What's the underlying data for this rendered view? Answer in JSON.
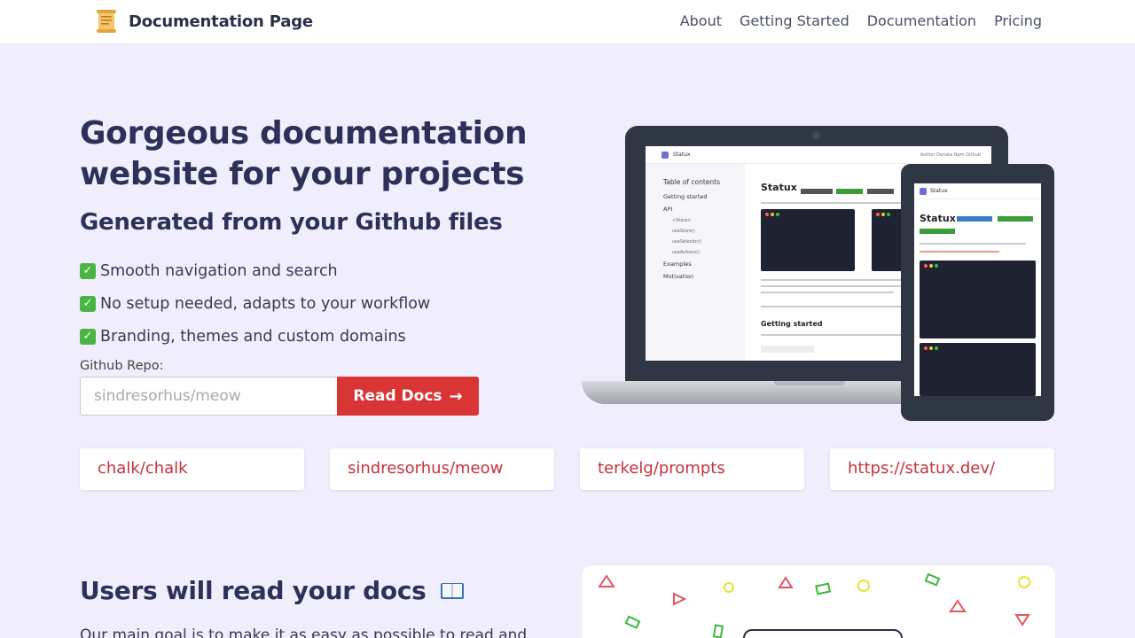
{
  "nav": {
    "brand": "Documentation Page",
    "links": [
      "About",
      "Getting Started",
      "Documentation",
      "Pricing"
    ]
  },
  "hero": {
    "title": "Gorgeous documentation website for your projects",
    "subtitle": "Generated from your Github files",
    "features": [
      "Smooth navigation and search",
      "No setup needed, adapts to your workflow",
      "Branding, themes and custom domains"
    ],
    "repo_label": "Github Repo:",
    "repo_placeholder": "sindresorhus/meow",
    "button_label": "Read Docs"
  },
  "examples": [
    "chalk/chalk",
    "sindresorhus/meow",
    "terkelg/prompts",
    "https://statux.dev/"
  ],
  "mockup": {
    "site_name": "Statux",
    "nav_links": "Author  Donate  Npm  Github",
    "toc_title": "Table of contents",
    "toc_items": [
      "Getting started",
      "API",
      "Examples",
      "Motivation"
    ],
    "toc_sub": [
      "<Store>",
      "useStore()",
      "useSelector()",
      "useActions()"
    ],
    "heading": "Statux",
    "section": "Getting started"
  },
  "section2": {
    "title": "Users will read your docs",
    "text": "Our main goal is to make it as easy as possible to read and"
  },
  "colors": {
    "accent": "#d93535",
    "title": "#2d3059",
    "background": "#f0eefc",
    "link": "#c8323a"
  },
  "icons": {
    "brand": "scroll-icon",
    "check": "check-mark-icon",
    "arrow": "arrow-right-icon",
    "book": "open-book-icon"
  }
}
